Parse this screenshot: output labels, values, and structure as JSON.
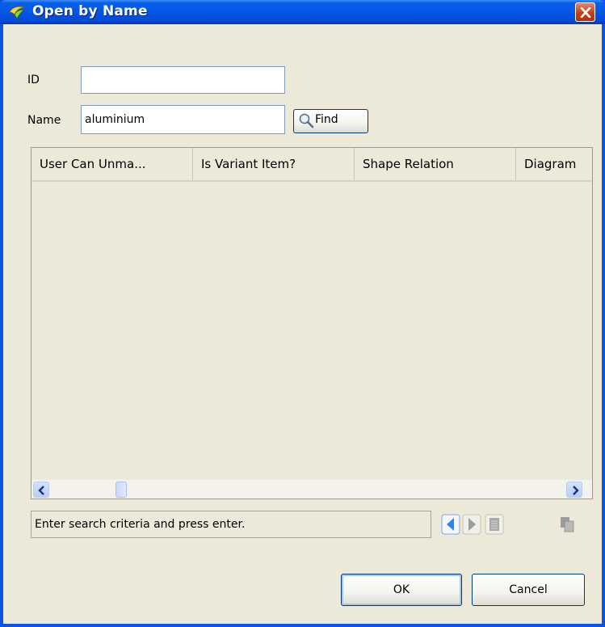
{
  "window": {
    "title": "Open by Name",
    "icons": {
      "app": "app-logo-icon",
      "close": "close-icon"
    }
  },
  "form": {
    "id_label": "ID",
    "id_value": "",
    "name_label": "Name",
    "name_value": "aluminium",
    "find_label": "Find",
    "find_icon": "magnifier-icon"
  },
  "table": {
    "columns": [
      "User Can Unma...",
      "Is Variant Item?",
      "Shape Relation",
      "Diagram"
    ],
    "rows": []
  },
  "status": {
    "text": "Enter search criteria and press enter.",
    "icons": [
      "prev-page-icon",
      "next-page-icon",
      "list-view-icon",
      "copy-icon"
    ]
  },
  "buttons": {
    "ok": "OK",
    "cancel": "Cancel"
  },
  "colors": {
    "title_bar": "#0257e6",
    "dialog_bg": "#ece9d8",
    "close_button": "#c53e1c",
    "accent": "#3a8bf2"
  }
}
